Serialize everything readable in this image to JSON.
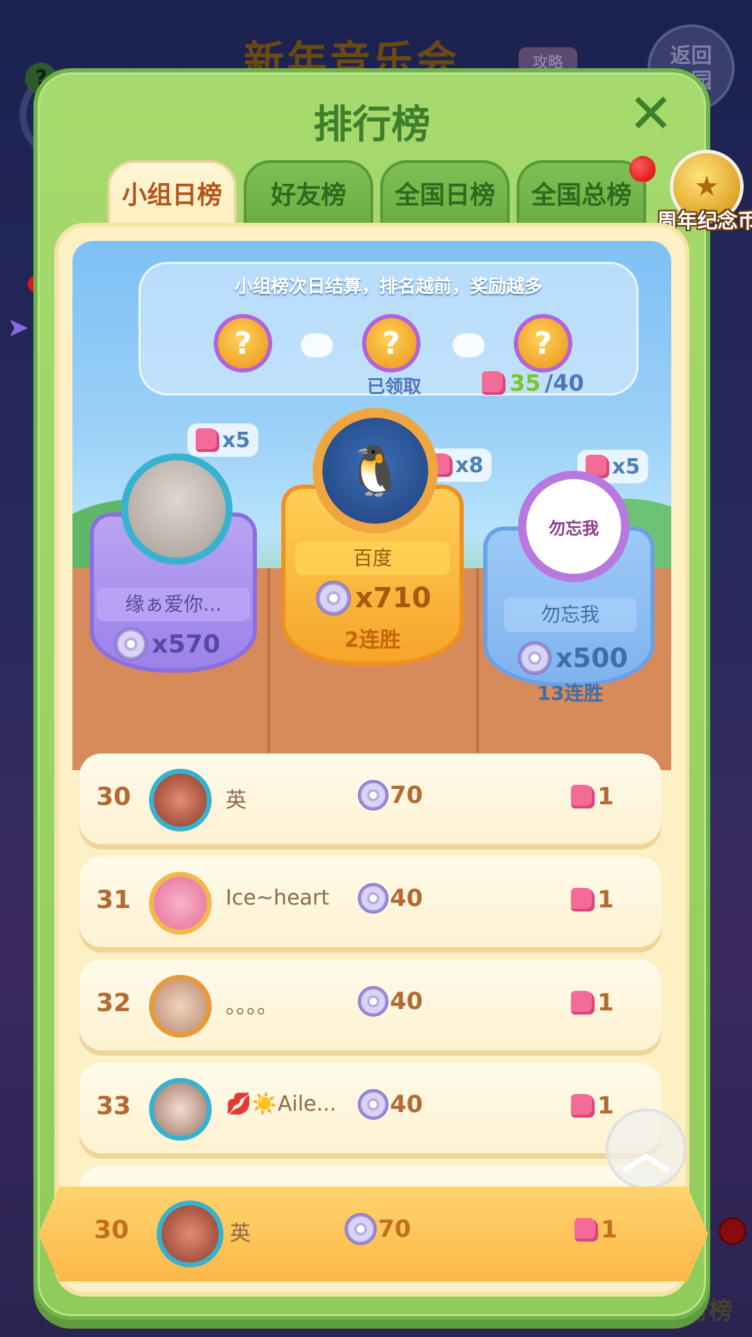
{
  "background": {
    "title": "新年音乐会",
    "tag": "攻略",
    "return_label": "返回\n庄园",
    "help_icon_label": "?",
    "bottom_label": "排行榜"
  },
  "panel": {
    "title": "排行榜",
    "close_icon": "close-icon",
    "tabs": [
      {
        "label": "小组日榜",
        "active": true
      },
      {
        "label": "好友榜",
        "active": false
      },
      {
        "label": "全国日榜",
        "active": false
      },
      {
        "label": "全国总榜",
        "active": false
      }
    ]
  },
  "anniversary_coin": {
    "label": "周年纪念币"
  },
  "info": {
    "text": "小组榜次日结算，排名越前，奖励越多",
    "step_label": "?",
    "claimed_label": "已领取",
    "progress_current": "35",
    "progress_total": "/40"
  },
  "podium": {
    "first": {
      "name": "百度",
      "score": "x710",
      "streak": "2连胜",
      "pieces": "x8"
    },
    "second": {
      "name": "缘ぁ爱你...",
      "score": "x570",
      "pieces": "x5"
    },
    "third": {
      "name": "勿忘我",
      "score": "x500",
      "streak": "13连胜",
      "pieces": "x5",
      "avatar_text": "勿忘我"
    }
  },
  "rows": [
    {
      "rank": "30",
      "name": "英",
      "score": "70",
      "pieces": "1"
    },
    {
      "rank": "31",
      "name": "Ice~heart",
      "score": "40",
      "pieces": "1"
    },
    {
      "rank": "32",
      "name": "。。。。",
      "score": "40",
      "pieces": "1"
    },
    {
      "rank": "33",
      "name": "💋☀️Aile...",
      "score": "40",
      "pieces": "1"
    }
  ],
  "self_row": {
    "rank": "30",
    "name": "英",
    "score": "70",
    "pieces": "1"
  },
  "colors": {
    "panel_green": "#8fcc5b",
    "tab_active": "#fdeebd",
    "first_place": "#f5a52a",
    "second_place": "#9b82ea",
    "third_place": "#7fb3ef",
    "self_row": "#fdb747"
  }
}
